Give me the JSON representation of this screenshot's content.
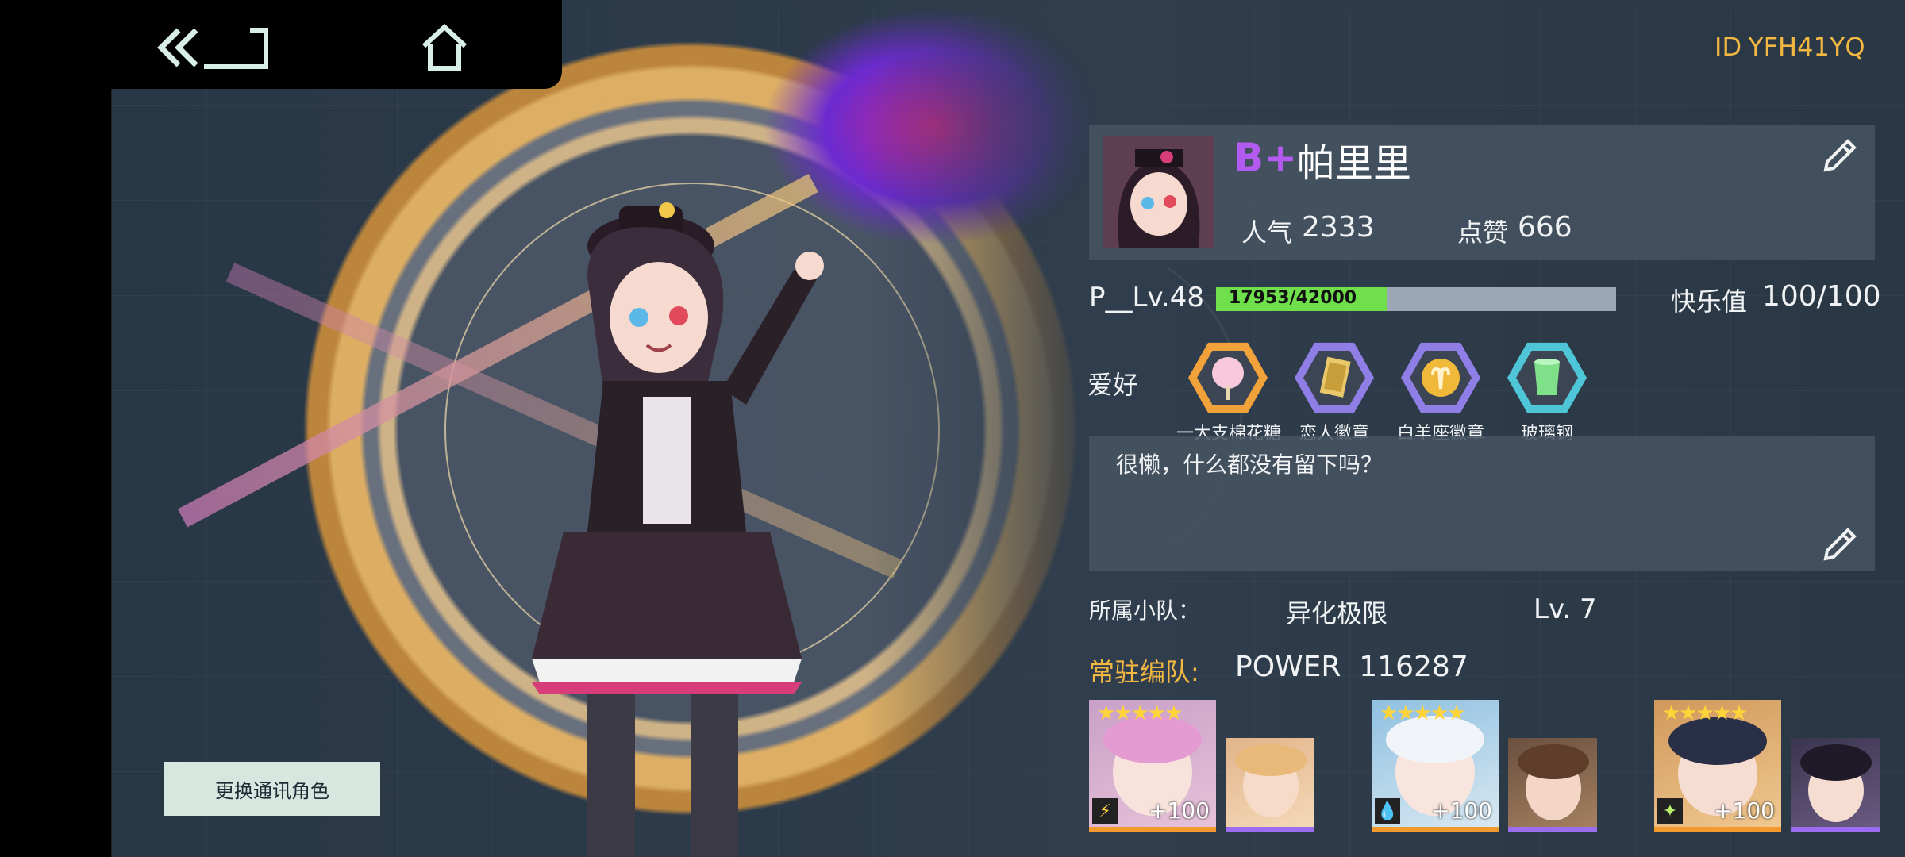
{
  "header": {
    "id_prefix": "ID",
    "id_value": "YFH41YQ"
  },
  "nav": {
    "back_icon": "double-chevron-back-icon",
    "home_icon": "home-icon"
  },
  "art": {
    "change_role_label": "更换通讯角色"
  },
  "profile": {
    "grade": "B+",
    "name": "帕里里",
    "popularity_label": "人气",
    "popularity_value": "2333",
    "likes_label": "点赞",
    "likes_value": "666",
    "level_label": "P__Lv.48",
    "xp_text": "17953/42000",
    "xp_fraction": 0.4274,
    "happiness_label": "快乐值",
    "happiness_value": "100/100"
  },
  "hobbies": {
    "label": "爱好",
    "items": [
      {
        "name": "一大支棉花糖",
        "icon": "cotton-candy-icon",
        "frame": "#f2a23a"
      },
      {
        "name": "恋人徽章",
        "icon": "lovers-card-badge-icon",
        "frame": "#8f7ee6"
      },
      {
        "name": "白羊座徽章",
        "icon": "aries-badge-icon",
        "frame": "#8f7ee6"
      },
      {
        "name": "玻璃钢",
        "icon": "glass-cup-icon",
        "frame": "#4fc6d8"
      }
    ]
  },
  "signature": {
    "text": "很懒，什么都没有留下吗？"
  },
  "squad": {
    "label": "所属小队：",
    "name": "异化极限",
    "level": "Lv. 7"
  },
  "team": {
    "label": "常驻编队:",
    "power_label": "POWER",
    "power_value": "116287",
    "units": [
      {
        "stars": "★★★★★",
        "bonus": "+100",
        "element_icon": "lightning-icon",
        "element_glyph": "⚡",
        "support_label": "support"
      },
      {
        "stars": "★★★★★",
        "bonus": "+100",
        "element_icon": "water-drop-icon",
        "element_glyph": "💧",
        "support_label": "support"
      },
      {
        "stars": "★★★★★",
        "bonus": "+100",
        "element_icon": "sparkle-icon",
        "element_glyph": "✦",
        "support_label": "support"
      }
    ]
  },
  "colors": {
    "accent_gold": "#f2b842",
    "grade_purple": "#b35bf0",
    "xp_green": "#6fe04c",
    "unit_border": "#f39a2e",
    "support_border": "#9b6df0"
  }
}
